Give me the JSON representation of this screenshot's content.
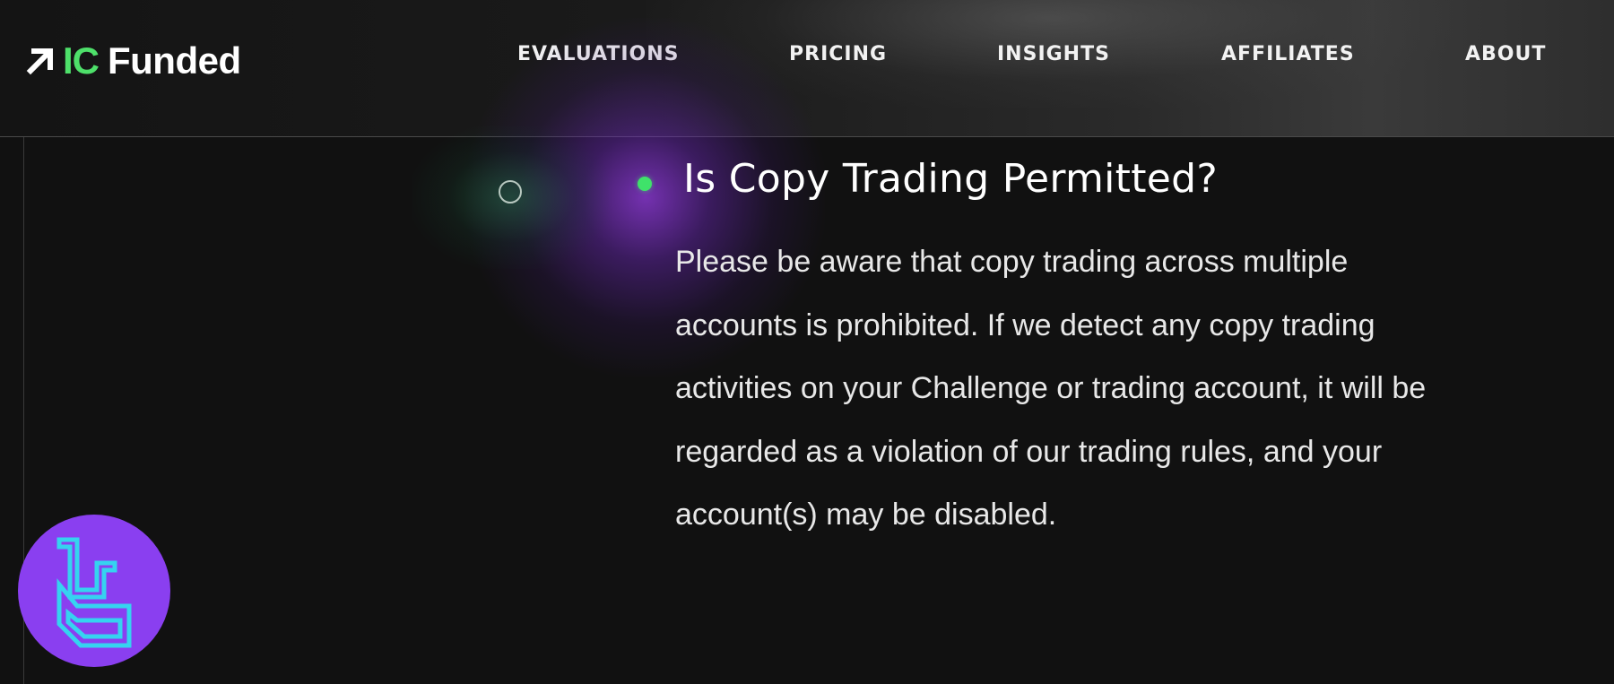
{
  "header": {
    "logo": {
      "brand_prefix": "IC",
      "brand_suffix": "Funded",
      "icon": "arrow-up-right-icon",
      "accent_color": "#4ee06a"
    },
    "nav": [
      {
        "label": "EVALUATIONS"
      },
      {
        "label": "PRICING"
      },
      {
        "label": "INSIGHTS"
      },
      {
        "label": "AFFILIATES"
      },
      {
        "label": "ABOUT"
      }
    ]
  },
  "faq": {
    "bullet_color": "#3fe26a",
    "title": "Is Copy Trading Permitted?",
    "answer_lines": [
      "Please be aware that copy trading across multiple",
      "accounts is prohibited. If we detect any copy trading",
      "activities on your Challenge or trading account, it will be",
      "regarded as a violation of our trading rules, and your",
      "account(s) may be disabled."
    ]
  },
  "badge": {
    "icon": "tradingfinder-logo-icon",
    "background_color": "#8a3ff0",
    "glyph_color": "#35d3f0"
  }
}
